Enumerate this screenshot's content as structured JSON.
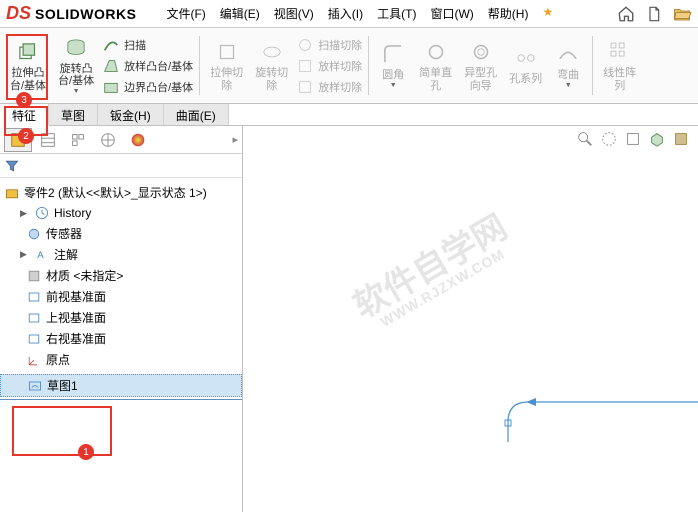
{
  "app": {
    "logo_ds": "DS",
    "logo_text": "SOLIDWORKS"
  },
  "menu": {
    "file": "文件(F)",
    "edit": "编辑(E)",
    "view": "视图(V)",
    "insert": "插入(I)",
    "tools": "工具(T)",
    "window": "窗口(W)",
    "help": "帮助(H)",
    "star": "★"
  },
  "ribbon": {
    "extrude": {
      "l1": "拉伸凸",
      "l2": "台/基体"
    },
    "revolve": {
      "l1": "旋转凸",
      "l2": "台/基体"
    },
    "sweep": "扫描",
    "loft": "放样凸台/基体",
    "boundary": "边界凸台/基体",
    "extrude_cut": {
      "l1": "拉伸切",
      "l2": "除"
    },
    "revolve_cut": {
      "l1": "旋转切",
      "l2": "除"
    },
    "sweep_cut": "扫描切除",
    "loft_cut": "放样切除",
    "boundary_cut": "放样切除",
    "fillet": "圆角",
    "straight_hole": {
      "l1": "简单直",
      "l2": "孔"
    },
    "hole_wizard": {
      "l1": "异型孔",
      "l2": "向导"
    },
    "hole_series": "孔系列",
    "bend": "弯曲",
    "linear_pattern": {
      "l1": "线性阵",
      "l2": "列"
    }
  },
  "tabs": {
    "feature": "特征",
    "sketch": "草图",
    "sheetmetal": "钣金(H)",
    "surface": "曲面(E)"
  },
  "tree": {
    "root": "零件2 (默认<<默认>_显示状态 1>)",
    "history": "History",
    "sensors": "传感器",
    "annotations": "注解",
    "material": "材质 <未指定>",
    "front": "前视基准面",
    "top": "上视基准面",
    "right": "右视基准面",
    "origin": "原点",
    "sketch1": "草图1"
  },
  "watermark": {
    "main": "软件自学网",
    "sub": "WWW.RJZXW.COM"
  },
  "annotations": {
    "b1": "1",
    "b2": "2",
    "b3": "3"
  }
}
